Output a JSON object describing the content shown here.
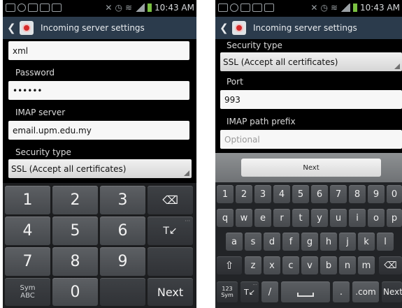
{
  "left_screen": {
    "status_bar": {
      "time": "10:43 AM"
    },
    "action_bar": {
      "title": "Incoming server settings",
      "app_icon": "email-app-icon"
    },
    "form": {
      "username_value": "xml",
      "password_label": "Password",
      "password_value": "••••••",
      "imap_server_label": "IMAP server",
      "imap_server_value": "email.upm.edu.my",
      "security_type_label": "Security type",
      "security_type_value": "SSL (Accept all certificates)"
    },
    "keypad": {
      "keys": [
        "1",
        "2",
        "3",
        "4",
        "5",
        "6",
        "7",
        "8",
        "9",
        "0"
      ],
      "backspace_icon": "backspace-icon",
      "sym_label": "Sym",
      "sym_sub_label": "ABC",
      "next_label": "Next",
      "text_mode_label": "T↙"
    }
  },
  "right_screen": {
    "status_bar": {
      "time": "10:43 AM"
    },
    "action_bar": {
      "title": "Incoming server settings",
      "app_icon": "email-app-icon"
    },
    "form": {
      "security_type_label": "Security type",
      "security_type_value": "SSL (Accept all certificates)",
      "port_label": "Port",
      "port_value": "993",
      "imap_path_prefix_label": "IMAP path prefix",
      "imap_path_prefix_placeholder": "Optional"
    },
    "keyboard": {
      "next_button_label": "Next",
      "number_row": [
        "1",
        "2",
        "3",
        "4",
        "5",
        "6",
        "7",
        "8",
        "9",
        "0"
      ],
      "row1": [
        "q",
        "w",
        "e",
        "r",
        "t",
        "y",
        "u",
        "i",
        "o",
        "p"
      ],
      "row2": [
        "a",
        "s",
        "d",
        "f",
        "g",
        "h",
        "j",
        "k",
        "l"
      ],
      "row3": [
        "z",
        "x",
        "c",
        "v",
        "b",
        "n",
        "m"
      ],
      "sym_label": "123",
      "sym_sub_label": "Sym",
      "text_mode_label": "T↙",
      "slash_label": "/",
      "period_label": ".",
      "dotcom_label": ".com",
      "next_label": "Next",
      "shift_icon": "shift-icon",
      "backspace_icon": "backspace-icon",
      "space_icon": "spacebar-icon"
    }
  }
}
